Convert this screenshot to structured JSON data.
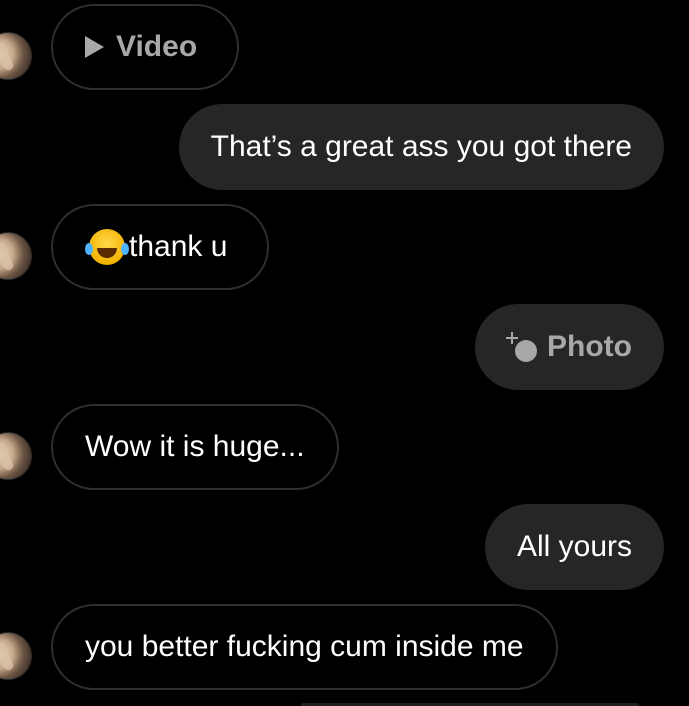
{
  "messages": [
    {
      "type": "media",
      "direction": "incoming",
      "label": "Video",
      "icon": "play-icon"
    },
    {
      "type": "text",
      "direction": "outgoing",
      "text": "That’s a great ass you got there"
    },
    {
      "type": "text",
      "direction": "incoming",
      "text": "thank u",
      "emoji": "face-with-tears-of-joy"
    },
    {
      "type": "media",
      "direction": "outgoing",
      "label": "Photo",
      "icon": "photo-icon"
    },
    {
      "type": "text",
      "direction": "incoming",
      "text": "Wow it is huge..."
    },
    {
      "type": "text",
      "direction": "outgoing",
      "text": "All yours"
    },
    {
      "type": "text",
      "direction": "incoming",
      "text": "you better fucking cum inside me"
    }
  ],
  "colors": {
    "background": "#000000",
    "outgoing_bubble": "#262626",
    "incoming_border": "#2e2e2e",
    "media_label": "#a8a8a8",
    "text": "#ffffff"
  }
}
